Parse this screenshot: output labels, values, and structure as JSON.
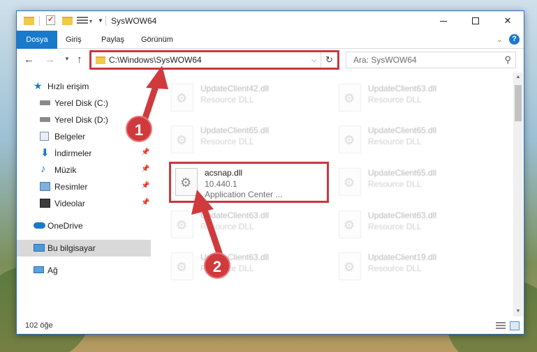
{
  "window": {
    "title": "SysWOW64",
    "controls": {
      "minimize": "—",
      "maximize": "",
      "close": "✕"
    }
  },
  "ribbon": {
    "tabs": [
      "Dosya",
      "Giriş",
      "Paylaş",
      "Görünüm"
    ],
    "help": "?"
  },
  "address": {
    "path": "C:\\Windows\\SysWOW64",
    "refresh": "↻"
  },
  "search": {
    "placeholder": "Ara: SysWOW64"
  },
  "navpane": {
    "items": [
      {
        "label": "Hızlı erişim",
        "icon": "star-icon"
      },
      {
        "label": "Yerel Disk (C:)",
        "icon": "drive-icon"
      },
      {
        "label": "Yerel Disk (D:)",
        "icon": "drive-icon"
      },
      {
        "label": "Belgeler",
        "icon": "documents-icon",
        "pinned": true
      },
      {
        "label": "İndirmeler",
        "icon": "download-icon",
        "pinned": true
      },
      {
        "label": "Müzik",
        "icon": "music-icon",
        "pinned": true
      },
      {
        "label": "Resimler",
        "icon": "pictures-icon",
        "pinned": true
      },
      {
        "label": "Videolar",
        "icon": "videos-icon",
        "pinned": true
      },
      {
        "label": "OneDrive",
        "icon": "cloud-icon"
      },
      {
        "label": "Bu bilgisayar",
        "icon": "computer-icon",
        "selected": true
      },
      {
        "label": "Ağ",
        "icon": "network-icon"
      }
    ]
  },
  "files": [
    {
      "name": "UpdateClient42.dll",
      "desc": "Resource DLL"
    },
    {
      "name": "UpdateClient63.dll",
      "desc": "Resource DLL"
    },
    {
      "name": "UpdateClient65.dll",
      "desc": "Resource DLL"
    },
    {
      "name": "UpdateClient65.dll",
      "desc": "Resource DLL"
    },
    {
      "name": "acsnap.dll",
      "desc": "10.440.1",
      "desc2": "Application Center ..."
    },
    {
      "name": "UpdateClient65.dll",
      "desc": "Resource DLL"
    },
    {
      "name": "UpdateClient63.dll",
      "desc": "Resource DLL"
    },
    {
      "name": "UpdateClient63.dll",
      "desc": "Resource DLL"
    },
    {
      "name": "UpdateClient63.dll",
      "desc": "Resource DLL"
    },
    {
      "name": "UpdateClient19.dll",
      "desc": "Resource DLL"
    }
  ],
  "status": {
    "count": "102 öğe"
  },
  "annotations": {
    "step1": "1",
    "step2": "2",
    "color": "#d03a3d"
  },
  "colors": {
    "accent": "#1979ca",
    "highlight": "#c8383d"
  }
}
